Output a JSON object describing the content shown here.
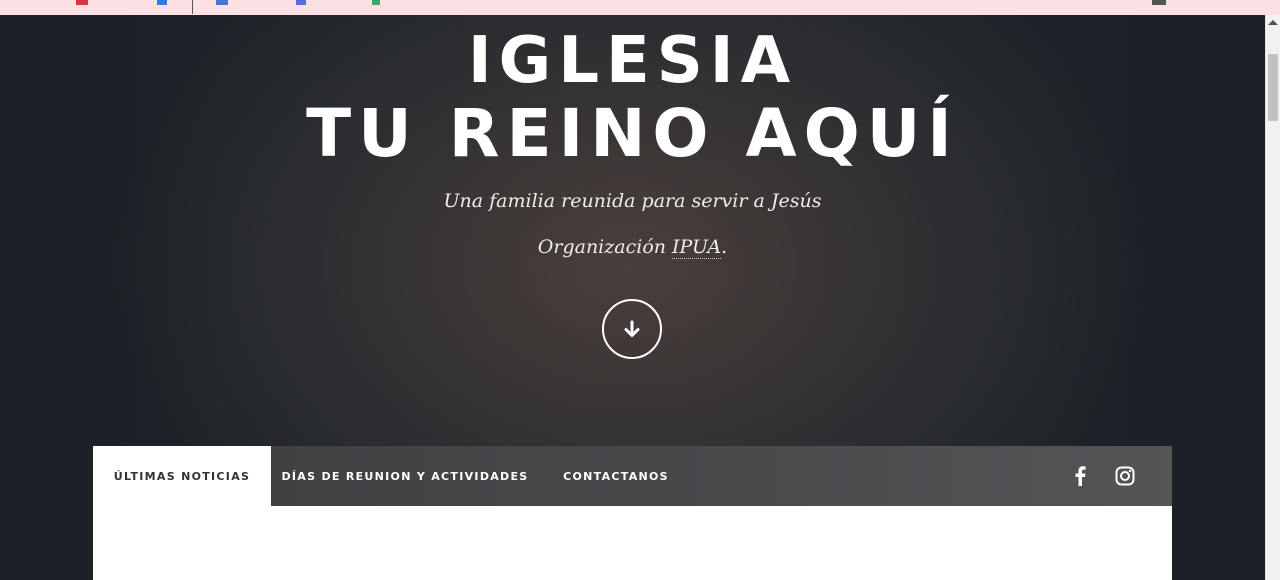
{
  "hero": {
    "title_line_1": "IGLESIA",
    "title_line_2": "TU REINO AQUÍ",
    "tagline_1": "Una familia reunida para servir a Jesús",
    "tagline_2_prefix": "Organización ",
    "tagline_2_abbr": "IPUA",
    "tagline_2_suffix": ".",
    "scroll_icon": "arrow-down-icon"
  },
  "tabs": [
    {
      "label": "ÚLTIMAS NOTICIAS",
      "active": true
    },
    {
      "label": "DÍAS DE REUNION Y ACTIVIDADES",
      "active": false
    },
    {
      "label": "CONTACTANOS",
      "active": false
    }
  ],
  "social": [
    {
      "icon": "facebook-icon"
    },
    {
      "icon": "instagram-icon"
    }
  ],
  "colors": {
    "browser_strip": "#fbe1e3",
    "tabbar": "#47474a",
    "active_tab": "#ffffff"
  }
}
